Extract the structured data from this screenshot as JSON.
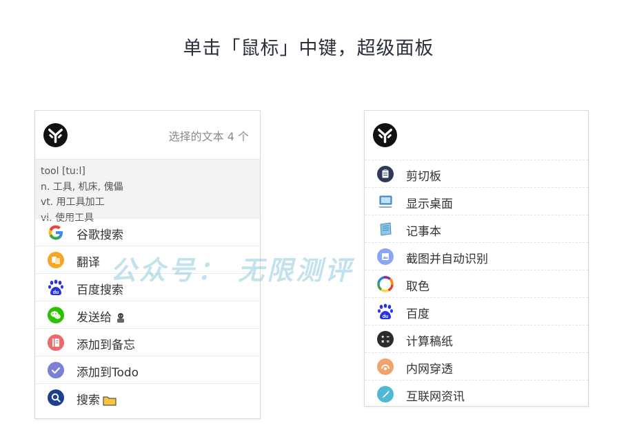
{
  "title": "单击「鼠标」中键，超级面板",
  "watermark": "公众号： 无限测评",
  "left_panel": {
    "selected_count": "选择的文本 4 个",
    "dict_lines": [
      "tool [tu:l]",
      "n. 工具, 机床, 傀儡",
      "vt. 用工具加工",
      "vi. 使用工具"
    ],
    "items": [
      {
        "label": "谷歌搜索",
        "icon": "google-icon"
      },
      {
        "label": "翻译",
        "icon": "translate-icon"
      },
      {
        "label": "百度搜索",
        "icon": "baidu-icon"
      },
      {
        "label": "发送给",
        "icon": "wechat-icon"
      },
      {
        "label": "添加到备忘",
        "icon": "memo-icon"
      },
      {
        "label": "添加到Todo",
        "icon": "todo-check-icon"
      },
      {
        "label": "搜索",
        "icon": "search-icon"
      }
    ]
  },
  "right_panel": {
    "items": [
      {
        "label": "剪切板",
        "icon": "clipboard-icon"
      },
      {
        "label": "显示桌面",
        "icon": "desktop-icon"
      },
      {
        "label": "记事本",
        "icon": "notepad-icon"
      },
      {
        "label": "截图并自动识别",
        "icon": "screenshot-ocr-icon"
      },
      {
        "label": "取色",
        "icon": "color-picker-icon"
      },
      {
        "label": "百度",
        "icon": "baidu-icon"
      },
      {
        "label": "计算稿纸",
        "icon": "calculator-icon"
      },
      {
        "label": "内网穿透",
        "icon": "tunnel-icon"
      },
      {
        "label": "互联网资讯",
        "icon": "news-rocket-icon"
      }
    ]
  },
  "colors": {
    "title": "#2a2f3a",
    "google_blue": "#4285f4",
    "wechat_green": "#2dc100",
    "baidu_blue": "#2932e1",
    "translate_orange": "#f5a623",
    "memo_red": "#e96b6b",
    "todo_purple": "#7a7fd8",
    "search_navy": "#1e3f8f"
  }
}
